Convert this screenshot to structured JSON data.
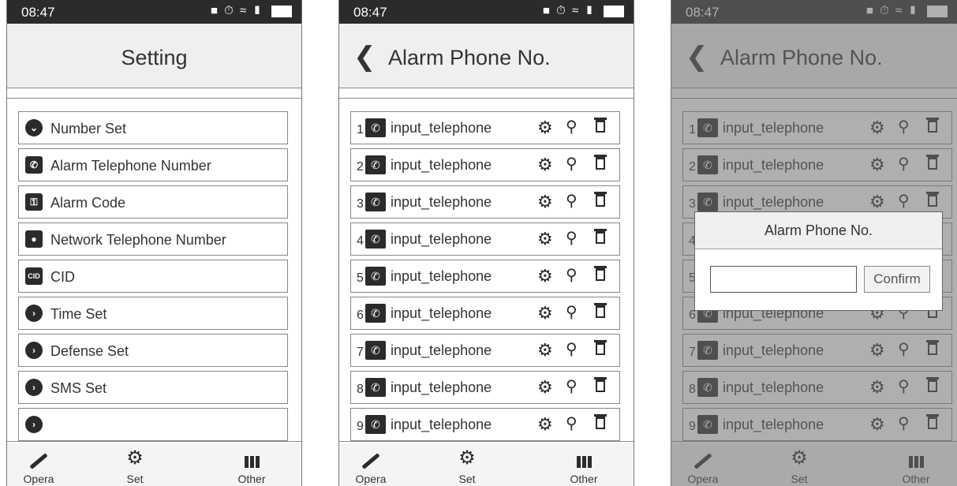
{
  "status": {
    "time": "08:47"
  },
  "setting_screen": {
    "title": "Setting",
    "menu": [
      {
        "label": "Number Set",
        "icon": "chevron-down-circle-icon"
      },
      {
        "label": "Alarm Telephone Number",
        "icon": "phone-handset-icon"
      },
      {
        "label": "Alarm Code",
        "icon": "unlock-icon"
      },
      {
        "label": "Network Telephone Number",
        "icon": "user-icon"
      },
      {
        "label": "CID",
        "icon": "cid-icon",
        "icon_text": "CID"
      },
      {
        "label": "Time Set",
        "icon": "chevron-right-circle-icon"
      },
      {
        "label": "Defense Set",
        "icon": "chevron-right-circle-icon"
      },
      {
        "label": "SMS Set",
        "icon": "chevron-right-circle-icon"
      },
      {
        "label": "",
        "icon": "chevron-right-circle-icon"
      }
    ]
  },
  "alarm_phone_screen": {
    "title": "Alarm Phone No.",
    "rows": [
      {
        "num": "1",
        "label": "input_telephone"
      },
      {
        "num": "2",
        "label": "input_telephone"
      },
      {
        "num": "3",
        "label": "input_telephone"
      },
      {
        "num": "4",
        "label": "input_telephone"
      },
      {
        "num": "5",
        "label": "input_telephone"
      },
      {
        "num": "6",
        "label": "input_telephone"
      },
      {
        "num": "7",
        "label": "input_telephone"
      },
      {
        "num": "8",
        "label": "input_telephone"
      },
      {
        "num": "9",
        "label": "input_telephone"
      }
    ]
  },
  "dialog": {
    "title": "Alarm Phone No.",
    "input_value": "",
    "confirm_label": "Confirm"
  },
  "tabbar": {
    "opera": "Opera",
    "set": "Set",
    "other": "Other"
  }
}
